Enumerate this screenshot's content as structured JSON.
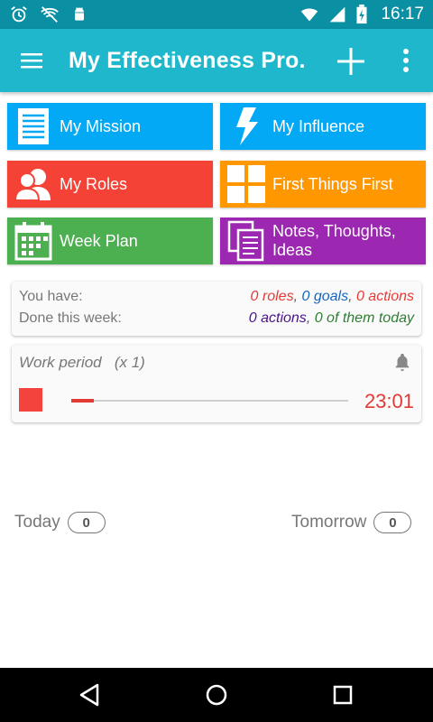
{
  "status_bar": {
    "time": "16:17",
    "icons": [
      "alarm-icon",
      "wifi-off-icon",
      "android-icon",
      "wifi-icon",
      "signal-icon",
      "battery-charging-icon"
    ]
  },
  "app_bar": {
    "title": "My Effectiveness Pro.",
    "color": "#1eb7cc",
    "icons": [
      "menu-icon",
      "add-icon",
      "more-vert-icon"
    ]
  },
  "tiles": [
    {
      "label": "My Mission",
      "color": "#03a9f4",
      "icon": "document-icon"
    },
    {
      "label": "My Influence",
      "color": "#03a9f4",
      "icon": "lightning-icon"
    },
    {
      "label": "My Roles",
      "color": "#f44336",
      "icon": "people-icon"
    },
    {
      "label": "First Things First",
      "color": "#ff9800",
      "icon": "grid-icon"
    },
    {
      "label": "Week Plan",
      "color": "#4caf50",
      "icon": "calendar-icon"
    },
    {
      "label": "Notes, Thoughts, Ideas",
      "color": "#9c27b0",
      "icon": "notes-icon"
    }
  ],
  "summary": {
    "you_have_label": "You have:",
    "done_label": "Done this week:",
    "roles": "0 roles",
    "goals": "0 goals",
    "actions": "0 actions",
    "week_actions": "0 actions",
    "week_today": "0 of them today",
    "sep": ", "
  },
  "work_period": {
    "label": "Work period",
    "multiplier": "(x 1)",
    "timer": "23:01",
    "progress": 0.08
  },
  "counts": {
    "today_label": "Today",
    "today_value": "0",
    "tomorrow_label": "Tomorrow",
    "tomorrow_value": "0"
  }
}
